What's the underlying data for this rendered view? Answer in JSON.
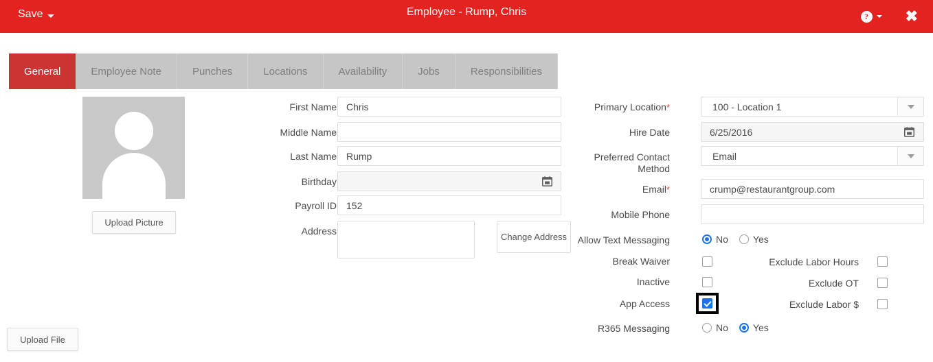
{
  "titlebar": {
    "save_label": "Save",
    "title": "Employee - Rump, Chris",
    "help_glyph": "?",
    "close_glyph": "✖"
  },
  "tabs": [
    {
      "label": "General",
      "active": true
    },
    {
      "label": "Employee Note",
      "active": false
    },
    {
      "label": "Punches",
      "active": false
    },
    {
      "label": "Locations",
      "active": false
    },
    {
      "label": "Availability",
      "active": false
    },
    {
      "label": "Jobs",
      "active": false
    },
    {
      "label": "Responsibilities",
      "active": false
    }
  ],
  "photo": {
    "upload_picture_label": "Upload Picture",
    "upload_file_label": "Upload File"
  },
  "left_form": {
    "first_name": {
      "label": "First Name",
      "value": "Chris"
    },
    "middle_name": {
      "label": "Middle Name",
      "value": ""
    },
    "last_name": {
      "label": "Last Name",
      "value": "Rump"
    },
    "birthday": {
      "label": "Birthday",
      "value": ""
    },
    "payroll_id": {
      "label": "Payroll ID",
      "value": "152"
    },
    "address": {
      "label": "Address",
      "value": ""
    },
    "change_address_label": "Change Address"
  },
  "right_form": {
    "primary_location": {
      "label": "Primary Location",
      "required": "*",
      "value": "100 - Location 1"
    },
    "hire_date": {
      "label": "Hire Date",
      "value": "6/25/2016"
    },
    "preferred_contact_method": {
      "label_line1": "Preferred Contact",
      "label_line2": "Method",
      "value": "Email"
    },
    "email": {
      "label": "Email",
      "required": "*",
      "value": "crump@restaurantgroup.com"
    },
    "mobile_phone": {
      "label": "Mobile Phone",
      "value": ""
    },
    "allow_text_messaging": {
      "label": "Allow Text Messaging",
      "no": "No",
      "yes": "Yes",
      "selected": "No"
    },
    "break_waiver": {
      "label": "Break Waiver",
      "checked": false
    },
    "inactive": {
      "label": "Inactive",
      "checked": false
    },
    "app_access": {
      "label": "App Access",
      "checked": true,
      "focused": true
    },
    "r365_messaging": {
      "label": "R365 Messaging",
      "no": "No",
      "yes": "Yes",
      "selected": "Yes"
    },
    "exclude_labor_hours": {
      "label": "Exclude Labor Hours",
      "checked": false
    },
    "exclude_ot": {
      "label": "Exclude OT",
      "checked": false
    },
    "exclude_labor_dollars": {
      "label": "Exclude Labor $",
      "checked": false
    }
  },
  "colors": {
    "header_red": "#e42320",
    "active_tab_red": "#cc3333",
    "inactive_tab_grey": "#c6c6c6",
    "required_red": "#e8453c",
    "control_blue": "#1a73e8"
  }
}
